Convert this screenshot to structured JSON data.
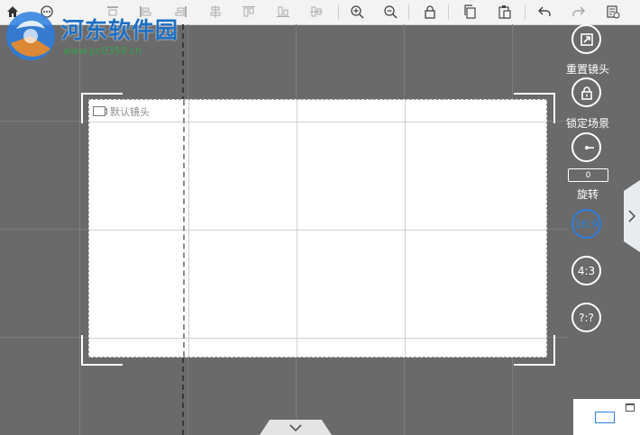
{
  "watermark": {
    "title": "河东软件园",
    "url": "www.pc0359.cn"
  },
  "toolbar": {
    "buttons": [
      {
        "icon": "home-icon"
      },
      {
        "icon": "more-icon"
      },
      {
        "icon": "align-top-icon"
      },
      {
        "icon": "align-left-icon"
      },
      {
        "icon": "align-right-icon"
      },
      {
        "icon": "align-center-vertical-icon"
      },
      {
        "icon": "align-top-edge-icon"
      },
      {
        "icon": "align-bottom-edge-icon"
      },
      {
        "icon": "align-middle-icon"
      },
      {
        "icon": "zoom-in-icon"
      },
      {
        "icon": "zoom-out-icon"
      },
      {
        "icon": "lock-icon"
      },
      {
        "icon": "copy-icon"
      },
      {
        "icon": "paste-icon"
      },
      {
        "icon": "undo-icon"
      },
      {
        "icon": "redo-icon"
      },
      {
        "icon": "properties-icon"
      }
    ]
  },
  "scene": {
    "camera_label": "默认镜头"
  },
  "right_panel": {
    "reset_camera_label": "重置镜头",
    "lock_scene_label": "锁定场景",
    "rotate_label": "旋转",
    "rotate_value": "0",
    "ratios": [
      "16:9",
      "4:3",
      "?:?"
    ],
    "active_ratio": "16:9",
    "accent_color": "#2a7ee0"
  }
}
